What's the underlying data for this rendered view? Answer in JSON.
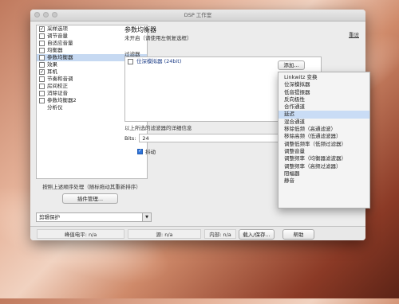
{
  "window": {
    "title": "DSP 工作室"
  },
  "sidebar": {
    "items": [
      {
        "label": "采样选项",
        "checked": true,
        "selected": false
      },
      {
        "label": "调节音量",
        "checked": false,
        "selected": false
      },
      {
        "label": "自适应音量",
        "checked": false,
        "selected": false
      },
      {
        "label": "均衡器",
        "checked": false,
        "selected": false
      },
      {
        "label": "参数均衡器",
        "checked": false,
        "selected": true
      },
      {
        "label": "效果",
        "checked": false,
        "selected": false
      },
      {
        "label": "耳机",
        "checked": true,
        "selected": false
      },
      {
        "label": "节奏和音调",
        "checked": false,
        "selected": false
      },
      {
        "label": "房间校正",
        "checked": false,
        "selected": false
      },
      {
        "label": "消除证音",
        "checked": false,
        "selected": false
      },
      {
        "label": "参数均衡器2",
        "checked": false,
        "selected": false
      },
      {
        "label": "分析仪",
        "checked": null,
        "selected": false
      }
    ],
    "note": "按照上述顺序处理（随标拖动其重新排序）",
    "plugin_manage_label": "插件管理...",
    "clip_select_value": "剪辑保护"
  },
  "main": {
    "title": "参数均衡器",
    "subtitle": "未开启（请使用左侧复选框）",
    "reset_label": "重设",
    "filters_label": "过滤器",
    "add_label": "添加...",
    "filters": [
      {
        "label": "位深模拟器 (24bit)",
        "checked": false
      }
    ],
    "details_label": "以上所选的滤波器的详细信息",
    "bits_label": "Bits:",
    "bits_value": "24",
    "dither_label": "抖动",
    "dither_checked": true
  },
  "add_menu": {
    "items": [
      "Linkwitz 变换",
      "位深模拟器",
      "低音提振器",
      "反向极性",
      "合作通道",
      "延迟",
      "混合通道",
      "移除低频（高通滤波）",
      "移除高频（低通滤波器）",
      "调整低频率（低频过滤器）",
      "调整音量",
      "调整频率（均衡器滤波器）",
      "调整频率（高频过滤器）",
      "阻幅器",
      "静音"
    ],
    "highlighted_index": 5
  },
  "status": {
    "peak_level": "峰值电平: n/a",
    "source": "源: n/a",
    "internal": "内部: n/a",
    "load_save_label": "载入/保存...",
    "help_label": "帮助"
  }
}
